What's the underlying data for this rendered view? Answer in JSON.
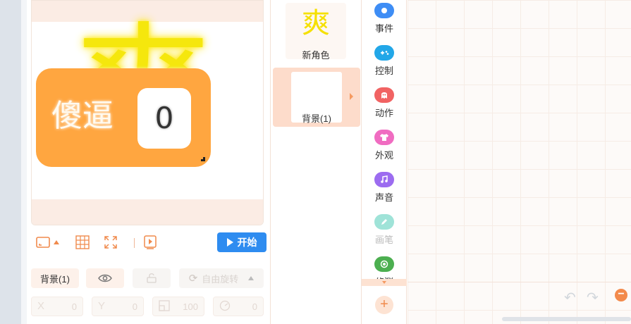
{
  "stage": {
    "sprite_glyph": "爽",
    "variable_monitor": {
      "label": "傻逼",
      "value": "0"
    }
  },
  "toolbar": {
    "start_label": "开始"
  },
  "properties": {
    "name": "背景(1)",
    "rotation_label": "自由旋转",
    "x_label": "X",
    "x_value": "0",
    "y_label": "Y",
    "y_value": "0",
    "size_value": "100",
    "direction_value": "0"
  },
  "sprites": {
    "new_sprite_glyph": "爽",
    "new_sprite_label": "新角色",
    "background_label": "背景(1)"
  },
  "categories": [
    {
      "label": "事件",
      "color": "#3e8df5",
      "icon": "toggle-icon"
    },
    {
      "label": "控制",
      "color": "#22a7e8",
      "icon": "gamepad-icon"
    },
    {
      "label": "动作",
      "color": "#f16363",
      "icon": "ghost-icon"
    },
    {
      "label": "外观",
      "color": "#f06cc1",
      "icon": "shirt-icon"
    },
    {
      "label": "声音",
      "color": "#9c6cf0",
      "icon": "music-icon"
    },
    {
      "label": "画笔",
      "color": "#9fe3d8",
      "icon": "pen-icon"
    },
    {
      "label": "侦测",
      "color": "#4caf50",
      "icon": "radar-icon"
    }
  ],
  "colors": {
    "accent": "#ffa640",
    "primary_button": "#2e8cf0",
    "panel_tint": "#fbece4"
  }
}
